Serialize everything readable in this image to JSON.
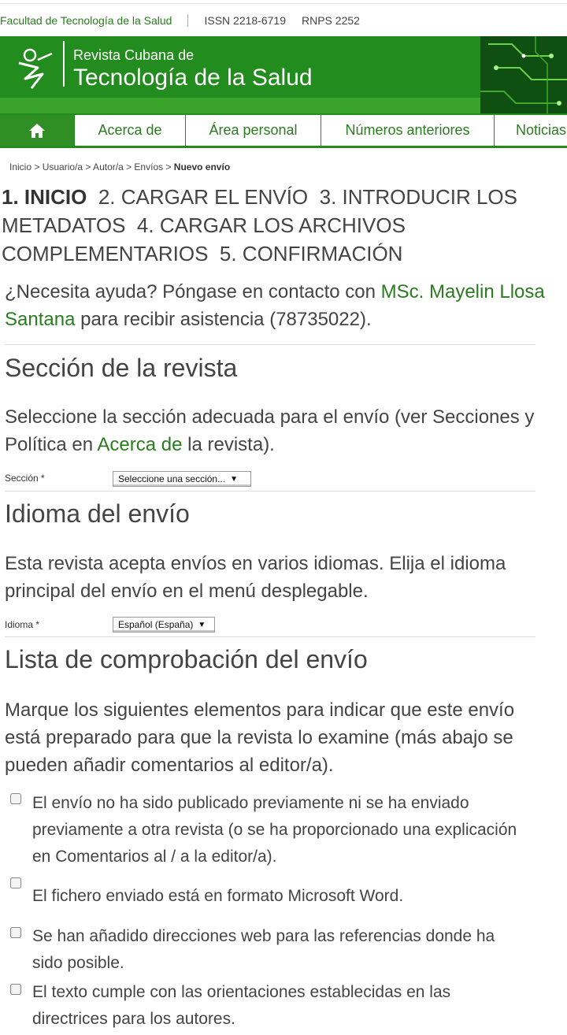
{
  "topbar": {
    "faculty": "Facultad de Tecnología de la Salud",
    "issn": "ISSN 2218-6719",
    "rnps": "RNPS 2252"
  },
  "banner": {
    "line1": "Revista Cubana de",
    "line2": "Tecnología de la Salud"
  },
  "nav": {
    "home_icon": "home-icon",
    "items": [
      "Acerca de",
      "Área personal",
      "Números anteriores",
      "Noticias"
    ]
  },
  "breadcrumb": {
    "path": "Inicio > Usuario/a > Autor/a > Envíos > ",
    "current": "Nuevo envío"
  },
  "steps": {
    "s1": "1. INICIO",
    "s2": "2. CARGAR EL ENVÍO",
    "s3": "3. INTRODUCIR LOS METADATOS",
    "s4": "4. CARGAR LOS ARCHIVOS COMPLEMENTARIOS",
    "s5": "5. CONFIRMACIÓN"
  },
  "help": {
    "before": "¿Necesita ayuda? Póngase en contacto con ",
    "contact": "MSc. Mayelin Llosa Santana",
    "after": " para recibir asistencia (78735022)."
  },
  "section": {
    "heading": "Sección de la revista",
    "text_before": "Seleccione la sección adecuada para el envío (ver Secciones y Política en ",
    "link": "Acerca de",
    "text_after": " la revista).",
    "label": "Sección *",
    "select_value": "Seleccione una sección..."
  },
  "language": {
    "heading": "Idioma del envío",
    "text": "Esta revista acepta envíos en varios idiomas. Elija el idioma principal del envío en el menú desplegable.",
    "label": "Idioma *",
    "select_value": "Español (España)"
  },
  "checklist": {
    "heading": "Lista de comprobación del envío",
    "intro": "Marque los siguientes elementos para indicar que este envío está preparado para que la revista lo examine (más abajo se pueden añadir comentarios al editor/a).",
    "items": [
      "El envío no ha sido publicado previamente ni se ha enviado previamente a otra revista (o se ha proporcionado una explicación en Comentarios al / a la editor/a).",
      "El fichero enviado está en formato Microsoft Word.",
      "Se han añadido direcciones web para las referencias donde ha sido posible.",
      "El texto cumple con las orientaciones establecidas en las directrices para los autores."
    ]
  },
  "colors": {
    "brand_green": "#238c1e",
    "link_green": "#2a7d1f"
  }
}
